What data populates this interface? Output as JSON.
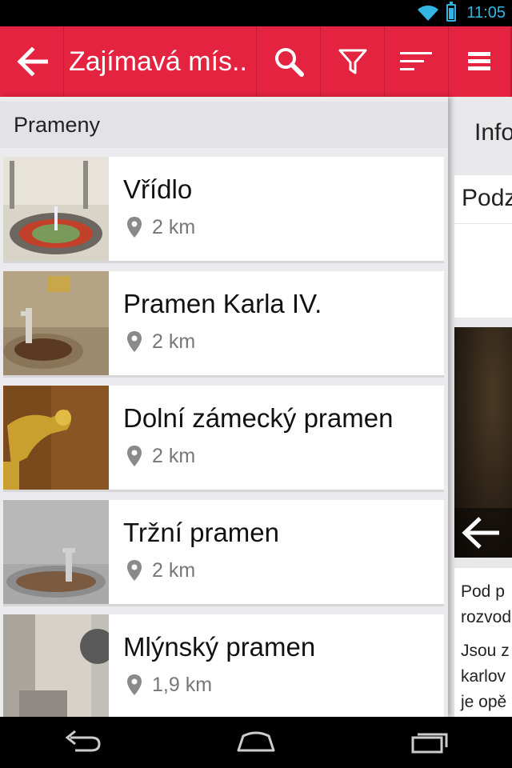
{
  "status_bar": {
    "time": "11:05"
  },
  "action_bar": {
    "title": "Zajímavá mís..",
    "icons": [
      "back-arrow-icon",
      "search-icon",
      "filter-icon",
      "sort-icon",
      "menu-icon"
    ]
  },
  "list": {
    "section": "Prameny",
    "items": [
      {
        "name": "Vřídlo",
        "distance": "2 km"
      },
      {
        "name": "Pramen Karla IV.",
        "distance": "2 km"
      },
      {
        "name": "Dolní zámecký pramen",
        "distance": "2 km"
      },
      {
        "name": "Tržní pramen",
        "distance": "2 km"
      },
      {
        "name": "Mlýnský pramen",
        "distance": "1,9 km"
      }
    ]
  },
  "detail_panel": {
    "tab": "Info",
    "card_title": "Podz",
    "text_lines": [
      "Pod p",
      "rozvod",
      "Jsou z",
      "karlov",
      "je opě"
    ]
  },
  "colors": {
    "accent": "#e3233f",
    "status_icons": "#33b5e5"
  }
}
